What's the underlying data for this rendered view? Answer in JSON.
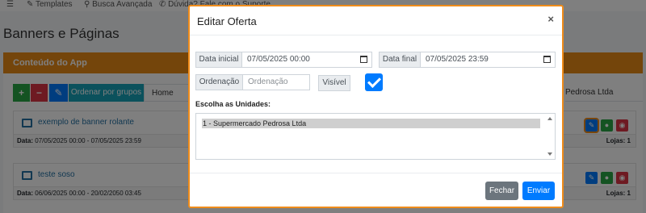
{
  "topnav": {
    "menu_icon": "hamburger-icon",
    "templates": "Templates",
    "busca": "Busca Avançada",
    "duvida": "Dúvida? Fale com o Suporte"
  },
  "page": {
    "title": "Banners e Páginas",
    "card_title": "Conteúdo do App",
    "toolbar": {
      "add": "+",
      "remove": "−",
      "order": "Ordenar por grupos"
    },
    "tab_home": "Home",
    "tab_right": "Pedrosa Ltda",
    "items": [
      {
        "title": "exemplo de banner rolante",
        "data_label": "Data:",
        "data": "07/05/2025 00:00 - 07/05/2025 23:59",
        "lojas": "Lojas: 1"
      },
      {
        "title": "teste soso",
        "data_label": "Data:",
        "data": "06/06/2025 00:00 - 20/02/2050 03:45",
        "lojas": "Lojas: 1"
      }
    ]
  },
  "modal": {
    "title": "Editar Oferta",
    "close": "×",
    "data_inicial_label": "Data inicial",
    "data_inicial_value": "07/05/2025 00:00",
    "data_final_label": "Data final",
    "data_final_value": "07/05/2025 23:59",
    "ordenacao_label": "Ordenação",
    "ordenacao_placeholder": "Ordenação",
    "visivel_label": "Visível",
    "visivel_checked": true,
    "unidades_label": "Escolha as Unidades:",
    "unidades_options": [
      "1 - Supermercado Pedrosa Ltda"
    ],
    "fechar": "Fechar",
    "enviar": "Enviar"
  },
  "colors": {
    "accent": "#f08c1a",
    "primary": "#007bff",
    "secondary": "#6c757d",
    "card_header": "#e98a17"
  }
}
